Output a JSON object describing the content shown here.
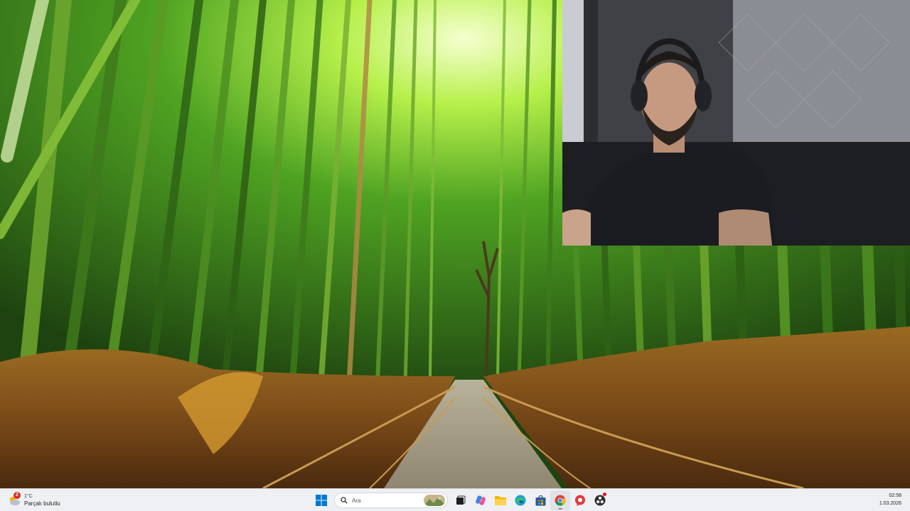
{
  "taskbar": {
    "weather": {
      "temperature": "1°C",
      "condition": "Parçalı bulutlu",
      "badge_count": "2",
      "icon": "weather-cloud-icon"
    },
    "search": {
      "placeholder": "Ara"
    },
    "pinned_apps": [
      {
        "name": "start",
        "icon": "windows-logo-icon"
      },
      {
        "name": "search",
        "icon": "search-icon"
      },
      {
        "name": "task-view",
        "icon": "task-view-icon"
      },
      {
        "name": "copilot",
        "icon": "copilot-icon"
      },
      {
        "name": "file-explorer",
        "icon": "folder-icon"
      },
      {
        "name": "edge",
        "icon": "edge-icon"
      },
      {
        "name": "store",
        "icon": "store-icon"
      },
      {
        "name": "chrome",
        "icon": "chrome-icon"
      },
      {
        "name": "chat",
        "icon": "chat-icon"
      },
      {
        "name": "obs",
        "icon": "obs-icon"
      }
    ],
    "clock": {
      "time": "02:58",
      "date": "1.03.2026"
    }
  },
  "colors": {
    "taskbar_bg": "#eef0f3",
    "accent_blue": "#0078d4",
    "badge_red": "#d62d20"
  }
}
